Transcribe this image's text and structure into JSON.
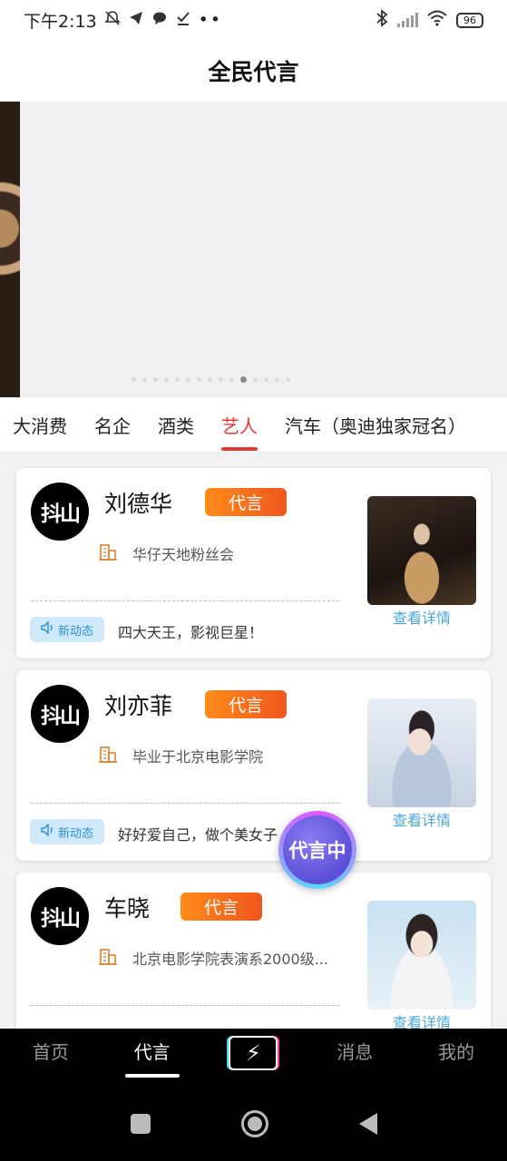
{
  "status_bar": {
    "time": "下午2:13",
    "battery": "96",
    "icons": [
      "mute-icon",
      "telegram-icon",
      "chat-icon",
      "check-icon",
      "more-dots-icon",
      "bluetooth-icon",
      "signal-icon",
      "wifi-icon",
      "battery-icon"
    ]
  },
  "header": {
    "title": "全民代言"
  },
  "banner": {
    "dot_count": 15,
    "active_dot": 10
  },
  "tabs": [
    {
      "label": "大消费",
      "active": false
    },
    {
      "label": "名企",
      "active": false
    },
    {
      "label": "酒类",
      "active": false
    },
    {
      "label": "艺人",
      "active": true
    },
    {
      "label": "汽车（奥迪独家冠名）",
      "active": false
    }
  ],
  "cards": [
    {
      "avatar_text": "抖山",
      "name": "刘德华",
      "badge": "代言",
      "org": "华仔天地粉丝会",
      "news_tag": "新动态",
      "news": "四大天王，影视巨星！",
      "detail": "查看详情"
    },
    {
      "avatar_text": "抖山",
      "name": "刘亦菲",
      "badge": "代言",
      "org": "毕业于北京电影学院",
      "news_tag": "新动态",
      "news": "好好爱自己，做个美女子",
      "detail": "查看详情"
    },
    {
      "avatar_text": "抖山",
      "name": "车晓",
      "badge": "代言",
      "org": "北京电影学院表演系2000级...",
      "news_tag": "",
      "news": "",
      "detail": "查看详情"
    }
  ],
  "float_button": {
    "label": "代言中"
  },
  "bottom_nav": [
    {
      "label": "首页",
      "active": false
    },
    {
      "label": "代言",
      "active": true
    },
    {
      "label": "",
      "icon": "lightning-icon",
      "active": false
    },
    {
      "label": "消息",
      "active": false
    },
    {
      "label": "我的",
      "active": false
    }
  ],
  "colors": {
    "accent_red": "#e53935",
    "badge_orange": "#f0561f",
    "link_blue": "#4ba8d8"
  }
}
